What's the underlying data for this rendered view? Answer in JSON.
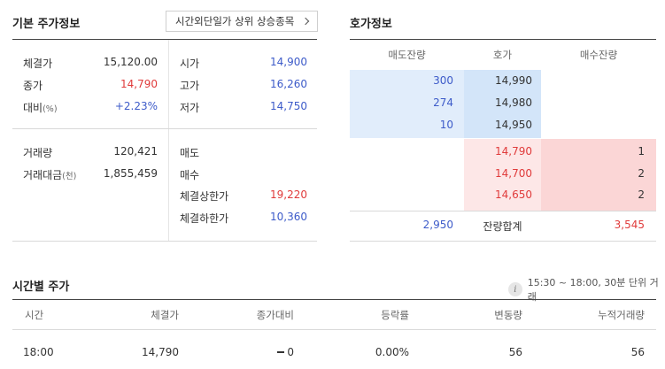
{
  "basic": {
    "title": "기본 주가정보",
    "after_hours_button": "시간외단일가 상위 상승종목",
    "rows_left": [
      {
        "label": "체결가",
        "value": "15,120.00",
        "value_color": "default"
      },
      {
        "label": "종가",
        "value": "14,790",
        "value_color": "red"
      },
      {
        "label": "대비",
        "label_suffix": "(%)",
        "value": "+2.23%",
        "value_color": "blue"
      }
    ],
    "rows_right": [
      {
        "label": "시가",
        "value": "14,900",
        "value_color": "blue"
      },
      {
        "label": "고가",
        "value": "16,260",
        "value_color": "blue"
      },
      {
        "label": "저가",
        "value": "14,750",
        "value_color": "blue"
      }
    ],
    "rows_left2": [
      {
        "label": "거래량",
        "value": "120,421"
      },
      {
        "label": "거래대금",
        "label_suffix": "(천)",
        "value": "1,855,459"
      }
    ],
    "rows_right2": [
      {
        "label": "매도",
        "value": ""
      },
      {
        "label": "매수",
        "value": ""
      },
      {
        "label": "체결상한가",
        "value": "19,220",
        "value_color": "red"
      },
      {
        "label": "체결하한가",
        "value": "10,360",
        "value_color": "blue"
      }
    ]
  },
  "orderbook": {
    "title": "호가정보",
    "headers": [
      "매도잔량",
      "호가",
      "매수잔량"
    ],
    "asks": [
      {
        "qty": "300",
        "price": "14,990"
      },
      {
        "qty": "274",
        "price": "14,980"
      },
      {
        "qty": "10",
        "price": "14,950"
      }
    ],
    "bids": [
      {
        "price": "14,790",
        "qty": "1"
      },
      {
        "price": "14,700",
        "qty": "2"
      },
      {
        "price": "14,650",
        "qty": "2"
      }
    ],
    "total_label": "잔량합계",
    "total_ask": "2,950",
    "total_bid": "3,545",
    "colors": {
      "ask_bg": "#e1edfb",
      "ask_price_bg": "#d3e5f9",
      "bid_bg": "#fde7e7",
      "bid_qty_bg": "#fbd6d6"
    }
  },
  "timeseries": {
    "title": "시간별 주가",
    "note": "15:30 ~ 18:00, 30분 단위 거래",
    "headers": [
      "시간",
      "체결가",
      "종가대비",
      "등락률",
      "변동량",
      "누적거래량"
    ],
    "rows": [
      {
        "time": "18:00",
        "price": "14,790",
        "change_icon": "flat-dash-icon",
        "change": "0",
        "rate": "0.00%",
        "vol": "56",
        "cum": "56"
      }
    ]
  }
}
